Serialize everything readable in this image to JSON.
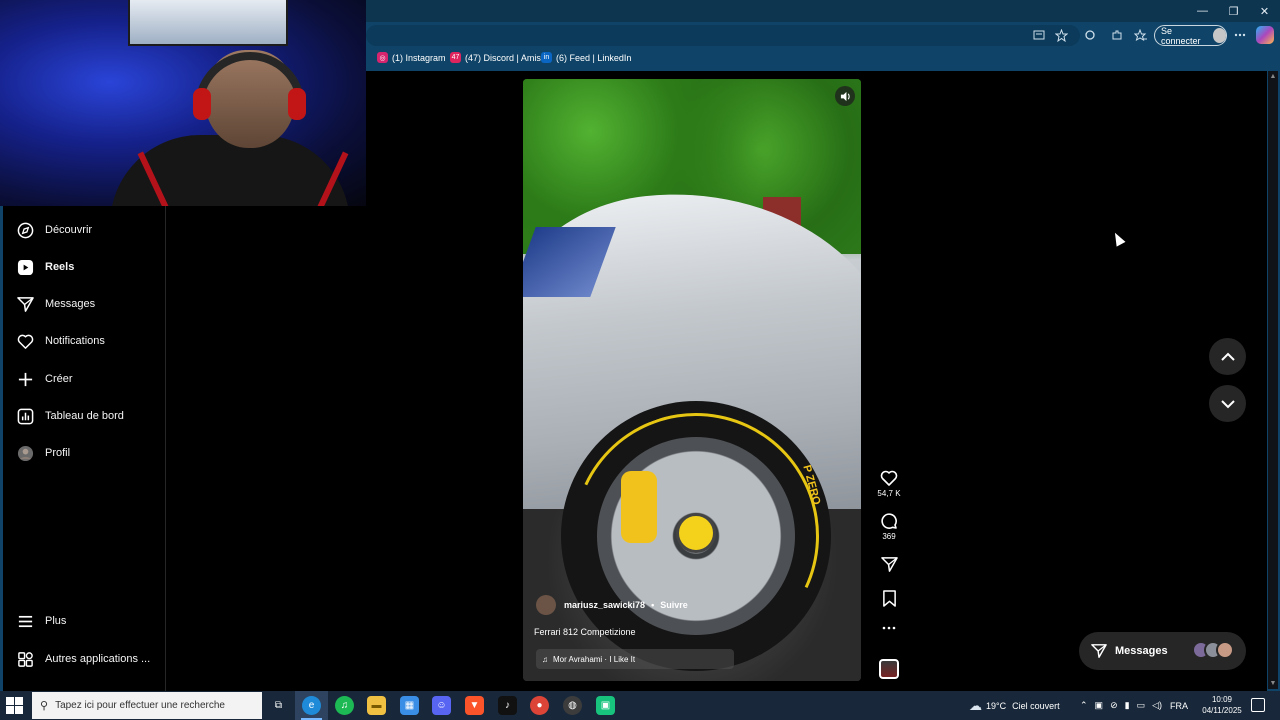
{
  "browser": {
    "window_controls": {
      "minimize": "—",
      "restore": "❐",
      "close": "✕"
    },
    "signin_label": "Se connecter",
    "favorites": [
      {
        "label": "(1) Instagram",
        "color": "#d6246e",
        "glyph": "◎"
      },
      {
        "label": "(47) Discord | Amis",
        "color": "#e0245e",
        "glyph": "47"
      },
      {
        "label": "(6) Feed | LinkedIn",
        "color": "#0a66c2",
        "glyph": "in"
      }
    ]
  },
  "sidebar": {
    "items": [
      {
        "label": "Découvrir",
        "icon": "compass-icon",
        "active": false
      },
      {
        "label": "Reels",
        "icon": "reels-icon",
        "active": true
      },
      {
        "label": "Messages",
        "icon": "send-icon",
        "active": false
      },
      {
        "label": "Notifications",
        "icon": "heart-icon",
        "active": false
      },
      {
        "label": "Créer",
        "icon": "plus-icon",
        "active": false
      },
      {
        "label": "Tableau de bord",
        "icon": "dashboard-icon",
        "active": false
      },
      {
        "label": "Profil",
        "icon": "avatar",
        "active": false
      }
    ],
    "bottom": [
      {
        "label": "Plus",
        "icon": "menu-icon"
      },
      {
        "label": "Autres applications ...",
        "icon": "apps-icon"
      }
    ]
  },
  "reel": {
    "username": "mariusz_sawicki78",
    "follow_label": "Suivre",
    "separator": "•",
    "caption": "Ferrari 812 Competizione",
    "audio": "Mor Avrahami · I Like It",
    "tire_text": "P ZERO",
    "likes": "54,7 K",
    "comments": "369"
  },
  "messages_pill": {
    "label": "Messages"
  },
  "taskbar": {
    "search_placeholder": "Tapez ici pour effectuer une recherche",
    "weather_temp": "19°C",
    "weather_desc": "Ciel couvert",
    "language": "FRA",
    "time": "10:09",
    "date": "04/11/2025",
    "apps": [
      {
        "name": "task-view-icon",
        "color": "transparent",
        "glyph": "⧉"
      },
      {
        "name": "edge-icon",
        "color": "#1f8bd8",
        "glyph": "e"
      },
      {
        "name": "spotify-icon",
        "color": "#1db954",
        "glyph": "♫"
      },
      {
        "name": "file-explorer-icon",
        "color": "#f0c043",
        "glyph": "▬"
      },
      {
        "name": "store-icon",
        "color": "#3a8ee6",
        "glyph": "▦"
      },
      {
        "name": "discord-icon",
        "color": "#5865f2",
        "glyph": "☺"
      },
      {
        "name": "brave-icon",
        "color": "#fb542b",
        "glyph": "▼"
      },
      {
        "name": "tiktok-icon",
        "color": "#111111",
        "glyph": "♪"
      },
      {
        "name": "chrome-icon",
        "color": "#db4437",
        "glyph": "●"
      },
      {
        "name": "obs-icon",
        "color": "#3c3c3c",
        "glyph": "◍"
      },
      {
        "name": "app-green-icon",
        "color": "#18c37e",
        "glyph": "▣"
      }
    ]
  },
  "colors": {
    "sidebar_border": "#262626",
    "browser_blue": "#0f4468",
    "taskbar": "#18283a"
  }
}
